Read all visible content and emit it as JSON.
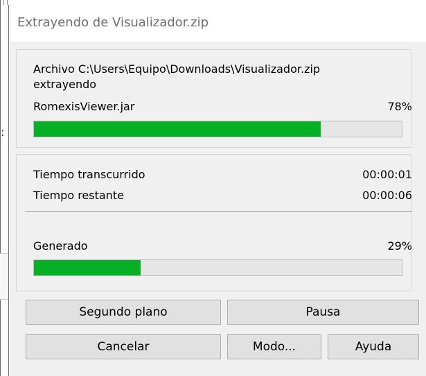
{
  "dialog": {
    "title": "Extrayendo de Visualizador.zip"
  },
  "extraction": {
    "archive_line": "Archivo C:\\Users\\Equipo\\Downloads\\Visualizador.zip",
    "action": "extrayendo",
    "current_file": "RomexisViewer.jar",
    "file_percent_label": "78%",
    "file_progress": 0.78
  },
  "timing": {
    "elapsed_label": "Tiempo transcurrido",
    "elapsed_value": "00:00:01",
    "remaining_label": "Tiempo restante",
    "remaining_value": "00:00:06"
  },
  "total": {
    "label": "Generado",
    "percent_label": "29%",
    "progress": 0.29
  },
  "buttons": {
    "background": "Segundo plano",
    "pause": "Pausa",
    "cancel": "Cancelar",
    "mode": "Modo...",
    "help": "Ayuda"
  },
  "colors": {
    "progress_fill": "#06b025",
    "progress_track": "#e6e6e6"
  }
}
